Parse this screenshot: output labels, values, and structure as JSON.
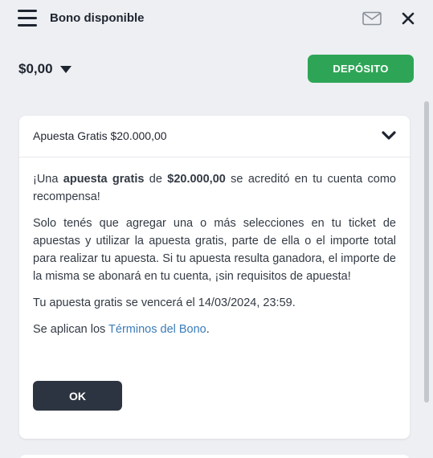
{
  "header": {
    "title": "Bono disponible",
    "menu_icon": "hamburger-menu-icon",
    "mail_icon": "envelope-icon",
    "close_icon": "close-icon"
  },
  "balance": {
    "amount": "$0,00",
    "deposit_label": "DEPÓSITO"
  },
  "bonus_card": {
    "title": "Apuesta Gratis $20.000,00",
    "p1_pre": "¡Una ",
    "p1_bold1": "apuesta gratis",
    "p1_mid": " de ",
    "p1_bold2": "$20.000,00",
    "p1_post": " se acreditó en tu cuenta como recompensa!",
    "p2": "Solo tenés que agregar una o más selecciones en tu ticket de apuestas y utilizar la apuesta gratis, parte de ella o el importe total para realizar tu apuesta. Si tu apuesta resulta ganadora, el importe de la misma se abonará en tu cuenta, ¡sin requisitos de apuesta!",
    "p3": "Tu apuesta gratis se vencerá el 14/03/2024, 23:59.",
    "p4_pre": "Se aplican los ",
    "p4_link": "Términos del Bono",
    "p4_post": ".",
    "ok_label": "OK"
  },
  "colors": {
    "deposit_green": "#2ea556",
    "ok_dark": "#2d3441",
    "link_blue": "#3b7cb8",
    "panel_bg": "#edeff2"
  }
}
